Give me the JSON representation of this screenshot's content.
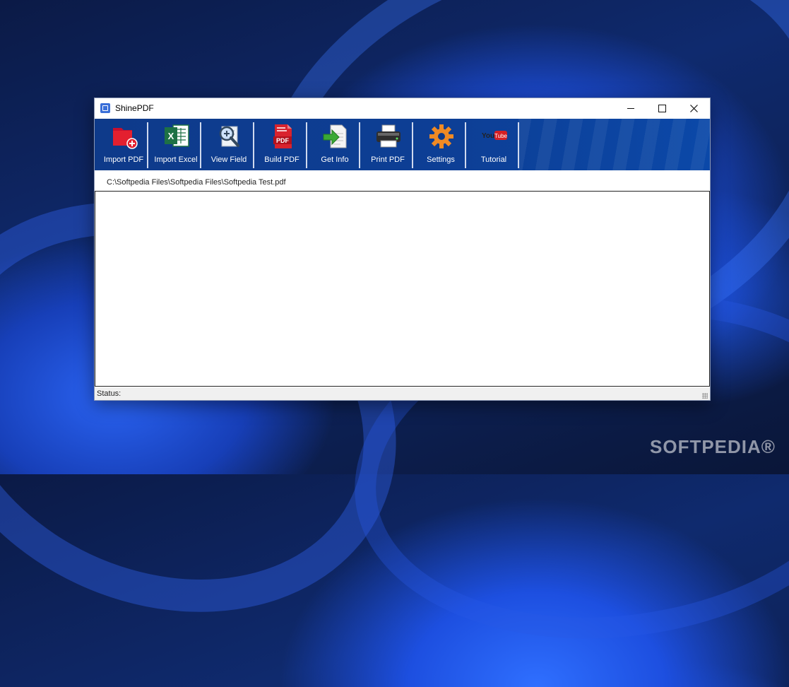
{
  "window": {
    "title": "ShinePDF",
    "icon": "shinepdf-app-icon",
    "controls": {
      "minimize": "minimize-icon",
      "maximize": "maximize-icon",
      "close": "close-icon"
    }
  },
  "toolbar": {
    "buttons": [
      {
        "label": "Import PDF",
        "icon": "import-pdf-icon"
      },
      {
        "label": "Import Excel",
        "icon": "excel-icon"
      },
      {
        "label": "View Field",
        "icon": "magnifier-icon"
      },
      {
        "label": "Build PDF",
        "icon": "pdf-document-icon"
      },
      {
        "label": "Get Info",
        "icon": "get-info-icon"
      },
      {
        "label": "Print PDF",
        "icon": "printer-icon"
      },
      {
        "label": "Settings",
        "icon": "gear-icon"
      },
      {
        "label": "Tutorial",
        "icon": "youtube-icon"
      }
    ]
  },
  "file_path": "C:\\Softpedia Files\\Softpedia Files\\Softpedia Test.pdf",
  "status": {
    "label": "Status:",
    "value": ""
  },
  "watermark": "SOFTPEDIA®",
  "colors": {
    "toolbar": "#0e3a8a",
    "accent": "#3a6fd8",
    "window_bg": "#ffffff"
  }
}
